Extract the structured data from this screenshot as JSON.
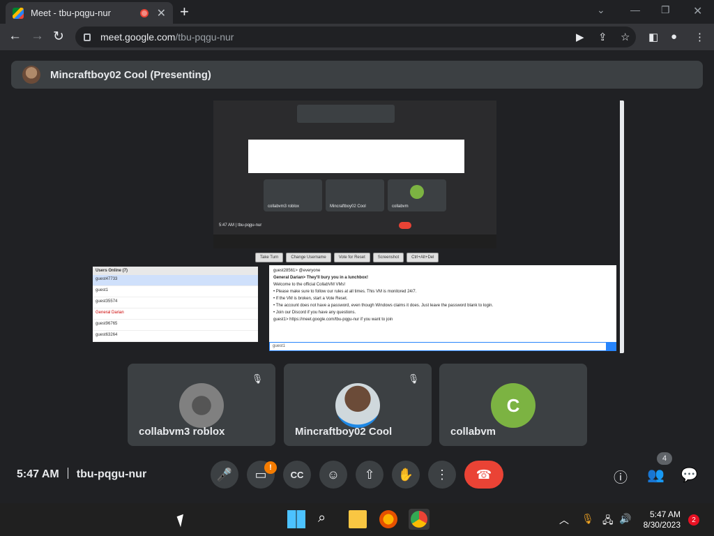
{
  "browser": {
    "tab_title": "Meet - tbu-pqgu-nur",
    "url_host": "meet.google.com",
    "url_path": "/tbu-pqgu-nur"
  },
  "meet": {
    "presenter": "Mincraftboy02 Cool (Presenting)",
    "time": "5:47 AM",
    "meeting_code": "tbu-pqgu-nur",
    "people_count": "4",
    "camera_badge": "!",
    "participants": [
      {
        "name": "collabvm3 roblox",
        "initial": ""
      },
      {
        "name": "Mincraftboy02 Cool",
        "initial": ""
      },
      {
        "name": "collabvm",
        "initial": "C"
      }
    ]
  },
  "shared_screen": {
    "inner_tiles": [
      "collabvm3 roblox",
      "Mincraftboy02 Cool",
      "collabvm"
    ],
    "inner_time_code": "5:47 AM  |  tbu-pqgu-nur",
    "vm_buttons": [
      "Take Turn",
      "Change Username",
      "Vote for Reset",
      "Screenshot",
      "Ctrl+Alt+Del"
    ],
    "users_header": "Users Online (7)",
    "users": [
      "guest47733",
      "guest1",
      "guest35574",
      "General Darian",
      "guest96765",
      "guest63264"
    ],
    "chat_lines": [
      "guest28561> @everyone",
      "General Darian> They'll bury you in a lunchbox!",
      "Welcome to the official CollabVM VMs!",
      "• Please make sure to follow our rules at all times. This VM is monitored 24/7.",
      "• If the VM is broken, start a Vote Reset.",
      "• The account does not have a password, even though Windows claims it does. Just leave the password blank to login.",
      "• Join our Discord if you have any questions.",
      "guest1> https://meet.google.com/tbu-pqgu-nur if you want to join"
    ],
    "chat_user": "guest1"
  },
  "taskbar": {
    "time": "5:47 AM",
    "date": "8/30/2023",
    "notifications": "2"
  },
  "colors": {
    "accent": "#ea4335",
    "avatar_green": "#7cb342",
    "badge_orange": "#f57c00"
  }
}
